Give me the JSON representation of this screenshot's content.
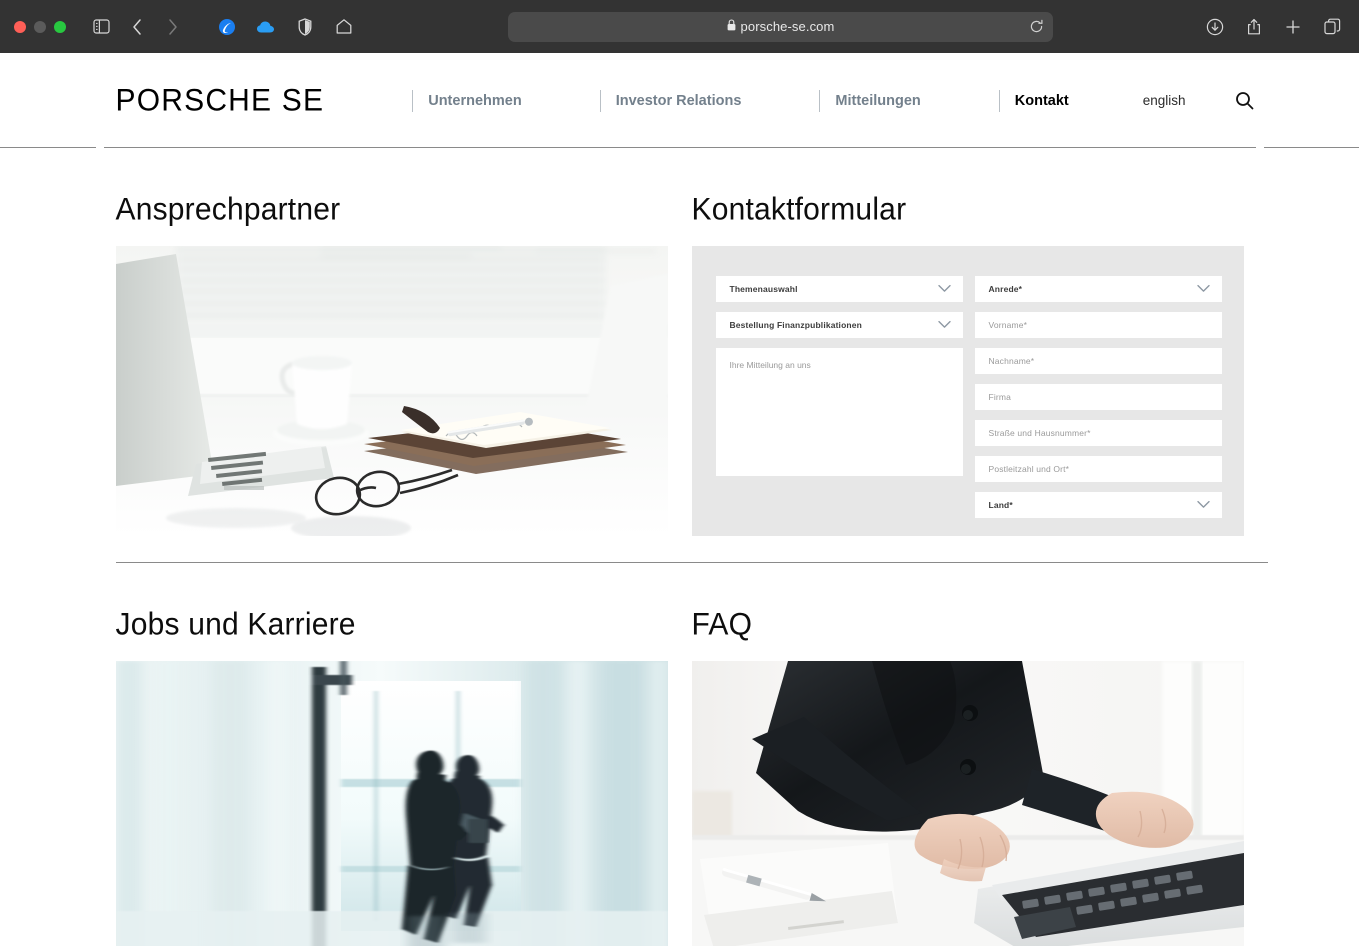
{
  "browser": {
    "url": "porsche-se.com",
    "lock_icon": "lock-icon",
    "traffic_lights": [
      "close",
      "minimize",
      "zoom"
    ],
    "toolbar_icons": [
      "sidebar-icon",
      "back-icon",
      "forward-icon",
      "extension-icon",
      "icloud-icon",
      "privacy-shield-icon",
      "home-icon",
      "reload-icon",
      "downloads-icon",
      "share-icon",
      "new-tab-icon",
      "tab-overview-icon"
    ]
  },
  "header": {
    "logo": "PORSCHE SE",
    "nav": [
      {
        "label": "Unternehmen",
        "active": false
      },
      {
        "label": "Investor Relations",
        "active": false
      },
      {
        "label": "Mitteilungen",
        "active": false
      },
      {
        "label": "Kontakt",
        "active": true
      }
    ],
    "language_link": "english",
    "search_icon": "search-icon"
  },
  "sections": {
    "ansprechpartner": {
      "title": "Ansprechpartner",
      "image_alt": "office desk with laptop, coffee cup, notebook and glasses"
    },
    "kontaktformular": {
      "title": "Kontaktformular"
    },
    "jobs": {
      "title": "Jobs und Karriere",
      "image_alt": "two business people walking through a bright lobby"
    },
    "faq": {
      "title": "FAQ",
      "image_alt": "person in dark blazer typing on a laptop next to a notepad and pen"
    }
  },
  "form": {
    "left": [
      {
        "name": "themenauswahl",
        "label": "Themenauswahl",
        "type": "select",
        "placeholder": false
      },
      {
        "name": "bestellung",
        "label": "Bestellung Finanzpublikationen",
        "type": "select",
        "placeholder": false
      },
      {
        "name": "mitteilung",
        "label": "Ihre Mitteilung an uns",
        "type": "textarea",
        "placeholder": true
      }
    ],
    "right": [
      {
        "name": "anrede",
        "label": "Anrede*",
        "type": "select",
        "placeholder": false
      },
      {
        "name": "vorname",
        "label": "Vorname*",
        "type": "text",
        "placeholder": true
      },
      {
        "name": "nachname",
        "label": "Nachname*",
        "type": "text",
        "placeholder": true
      },
      {
        "name": "firma",
        "label": "Firma",
        "type": "text",
        "placeholder": true
      },
      {
        "name": "strasse",
        "label": "Straße und Hausnummer*",
        "type": "text",
        "placeholder": true
      },
      {
        "name": "plz-ort",
        "label": "Postleitzahl und Ort*",
        "type": "text",
        "placeholder": true
      },
      {
        "name": "land",
        "label": "Land*",
        "type": "select",
        "placeholder": false
      }
    ]
  },
  "colors": {
    "chrome_bg": "#333333",
    "url_bar_bg": "#4a4a4a",
    "nav_text": "#73808c",
    "nav_active": "#000000",
    "form_panel_bg": "#e7e7e7",
    "rule": "#8a8a8a"
  }
}
